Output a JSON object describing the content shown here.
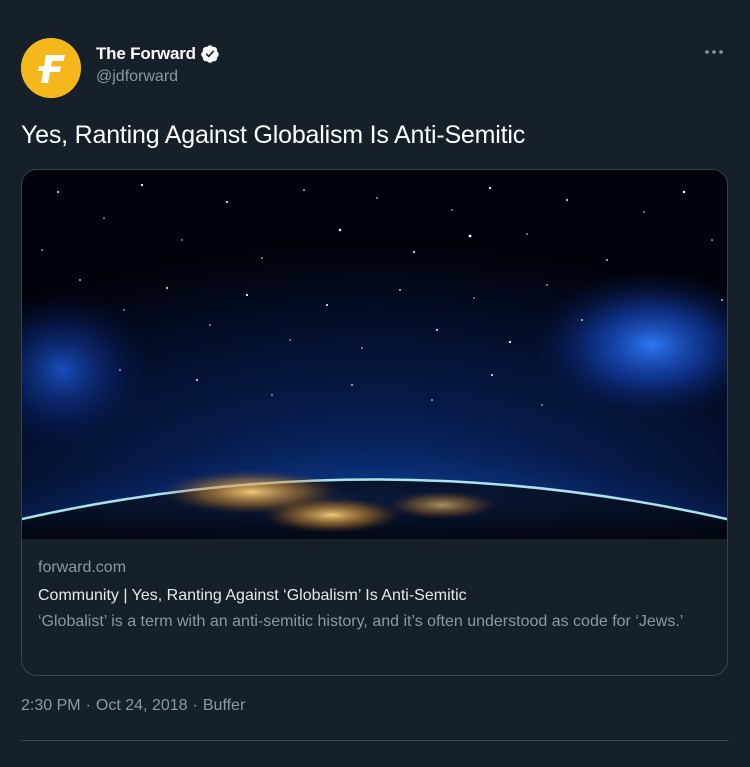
{
  "author": {
    "display_name": "The Forward",
    "handle": "@jdforward",
    "verified": true,
    "avatar_icon": "forward-logo-icon",
    "avatar_color": "#f5b81c"
  },
  "tweet": {
    "text": "Yes, Ranting Against Globalism Is Anti-Semitic"
  },
  "card": {
    "image_icon": "earth-from-space-image",
    "domain": "forward.com",
    "title": "Community | Yes, Ranting Against ‘Globalism’ Is Anti-Semitic",
    "description": "‘Globalist’ is a term with an anti-semitic history, and it’s often understood as code for ‘Jews.’"
  },
  "meta": {
    "time": "2:30 PM",
    "date": "Oct 24, 2018",
    "source": "Buffer",
    "separator": "·"
  },
  "colors": {
    "background": "#15202b",
    "secondary_text": "#8b98a5",
    "border": "#38444d",
    "verified_badge": "#ffffff"
  }
}
